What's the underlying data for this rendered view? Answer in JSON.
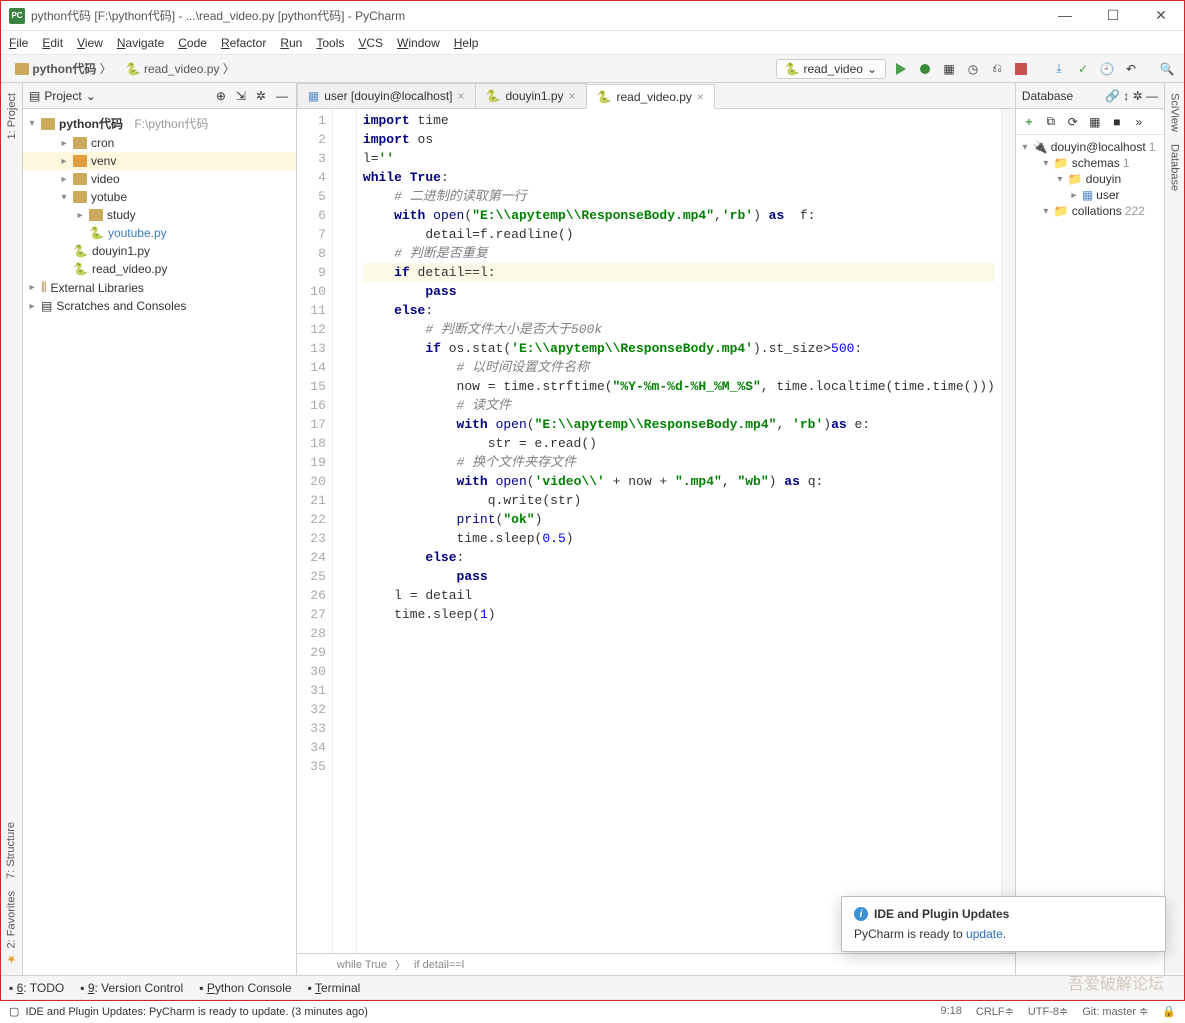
{
  "window": {
    "title": "python代码 [F:\\python代码] - ...\\read_video.py [python代码] - PyCharm",
    "min": "—",
    "max": "☐",
    "close": "✕"
  },
  "menu": [
    "File",
    "Edit",
    "View",
    "Navigate",
    "Code",
    "Refactor",
    "Run",
    "Tools",
    "VCS",
    "Window",
    "Help"
  ],
  "crumbs": [
    "python代码",
    "read_video.py"
  ],
  "run_config": "read_video",
  "project_panel": {
    "title": "Project",
    "root": {
      "name": "python代码",
      "hint": "F:\\python代码"
    },
    "tree": [
      {
        "kind": "folder",
        "name": "cron",
        "depth": 1
      },
      {
        "kind": "folder",
        "name": "venv",
        "depth": 1,
        "sel": true,
        "orange": true
      },
      {
        "kind": "folder",
        "name": "video",
        "depth": 1
      },
      {
        "kind": "folder",
        "name": "yotube",
        "depth": 1,
        "open": true
      },
      {
        "kind": "folder",
        "name": "study",
        "depth": 2
      },
      {
        "kind": "py",
        "name": "youtube.py",
        "depth": 2,
        "blue": true
      },
      {
        "kind": "py",
        "name": "douyin1.py",
        "depth": 1
      },
      {
        "kind": "py",
        "name": "read_video.py",
        "depth": 1
      }
    ],
    "extlib": "External Libraries",
    "scratches": "Scratches and Consoles"
  },
  "tabs": [
    {
      "label": "user [douyin@localhost]",
      "icon": "table"
    },
    {
      "label": "douyin1.py",
      "icon": "py"
    },
    {
      "label": "read_video.py",
      "icon": "py",
      "active": true
    }
  ],
  "code_lines": [
    {
      "n": 1,
      "html": "<span class='kw'>import</span> time"
    },
    {
      "n": 2,
      "html": "<span class='kw'>import</span> os"
    },
    {
      "n": 3,
      "html": "l=<span class='st'>''</span>"
    },
    {
      "n": 4,
      "html": "<span class='kw'>while</span> <span class='kw'>True</span>:"
    },
    {
      "n": 5,
      "html": "    <span class='cm'># 二进制的读取第一行</span>"
    },
    {
      "n": 6,
      "html": "    <span class='kw'>with</span> <span class='bi'>open</span>(<span class='st'>\"E:\\\\apytemp\\\\ResponseBody.mp4\"</span>,<span class='st'>'rb'</span>) <span class='kw'>as</span>  f:"
    },
    {
      "n": 7,
      "html": "        detail=f.readline()"
    },
    {
      "n": 8,
      "html": "    <span class='cm'># 判断是否重复</span>"
    },
    {
      "n": 9,
      "html": "    <span class='kw'>if</span> detail==l:",
      "hl": true
    },
    {
      "n": 10,
      "html": "        <span class='kw'>pass</span>"
    },
    {
      "n": 11,
      "html": "    <span class='kw'>else</span>:"
    },
    {
      "n": 12,
      "html": "        <span class='cm'># 判断文件大小是否大于500k</span>"
    },
    {
      "n": 13,
      "html": "        <span class='kw'>if</span> os.stat(<span class='st'>'E:\\\\apytemp\\\\ResponseBody.mp4'</span>).st_size&gt;<span class='nm'>500</span>:"
    },
    {
      "n": 14,
      "html": "            <span class='cm'># 以时间设置文件名称</span>"
    },
    {
      "n": 15,
      "html": "            now = time.strftime(<span class='st'>\"%Y-%m-%d-%H_%M_%S\"</span>, time.localtime(time.time()))"
    },
    {
      "n": 16,
      "html": "            <span class='cm'># 读文件</span>"
    },
    {
      "n": 17,
      "html": "            <span class='kw'>with</span> <span class='bi'>open</span>(<span class='st'>\"E:\\\\apytemp\\\\ResponseBody.mp4\"</span>, <span class='st'>'rb'</span>)<span class='kw'>as</span> e:"
    },
    {
      "n": 18,
      "html": "                str = e.read()"
    },
    {
      "n": 19,
      "html": "            <span class='cm'># 换个文件夹存文件</span>"
    },
    {
      "n": 20,
      "html": "            <span class='kw'>with</span> <span class='bi'>open</span>(<span class='st'>'video\\\\'</span> + now + <span class='st'>\".mp4\"</span>, <span class='st'>\"wb\"</span>) <span class='kw'>as</span> q:"
    },
    {
      "n": 21,
      "html": "                q.write(str)"
    },
    {
      "n": 22,
      "html": "            <span class='bi'>print</span>(<span class='st'>\"ok\"</span>)"
    },
    {
      "n": 23,
      "html": "            time.sleep(<span class='nm'>0.5</span>)"
    },
    {
      "n": 24,
      "html": "        <span class='kw'>else</span>:"
    },
    {
      "n": 25,
      "html": "            <span class='kw'>pass</span>"
    },
    {
      "n": 26,
      "html": "    l = detail"
    },
    {
      "n": 27,
      "html": "    time.sleep(<span class='nm'>1</span>)"
    },
    {
      "n": 28,
      "html": ""
    },
    {
      "n": 29,
      "html": ""
    },
    {
      "n": 30,
      "html": ""
    },
    {
      "n": 31,
      "html": ""
    },
    {
      "n": 32,
      "html": ""
    },
    {
      "n": 33,
      "html": ""
    },
    {
      "n": 34,
      "html": ""
    },
    {
      "n": 35,
      "html": ""
    }
  ],
  "editor_crumb": [
    "while True",
    "if detail==l"
  ],
  "db": {
    "title": "Database",
    "root": "douyin@localhost",
    "root_badge": "1",
    "items": [
      {
        "d": 1,
        "t": "schemas",
        "b": "1"
      },
      {
        "d": 2,
        "t": "douyin"
      },
      {
        "d": 3,
        "t": "user",
        "icon": "table"
      },
      {
        "d": 1,
        "t": "collations",
        "b": "222"
      }
    ]
  },
  "right_tabs": [
    "SciView",
    "Database"
  ],
  "bottom_tools": [
    {
      "l": "6: TODO"
    },
    {
      "l": "9: Version Control"
    },
    {
      "l": "Python Console"
    },
    {
      "l": "Terminal"
    }
  ],
  "status_msg": "IDE and Plugin Updates: PyCharm is ready to update. (3 minutes ago)",
  "status_right": {
    "pos": "9:18",
    "eol": "CRLF",
    "enc": "UTF-8",
    "git": "Git: master",
    "lock": "🔒"
  },
  "popup": {
    "title": "IDE and Plugin Updates",
    "body": "PyCharm is ready to ",
    "link": "update",
    "dot": "."
  },
  "left_tabs": [
    "1: Project",
    "7: Structure",
    "2: Favorites"
  ],
  "watermark": "吾爱破解论坛"
}
